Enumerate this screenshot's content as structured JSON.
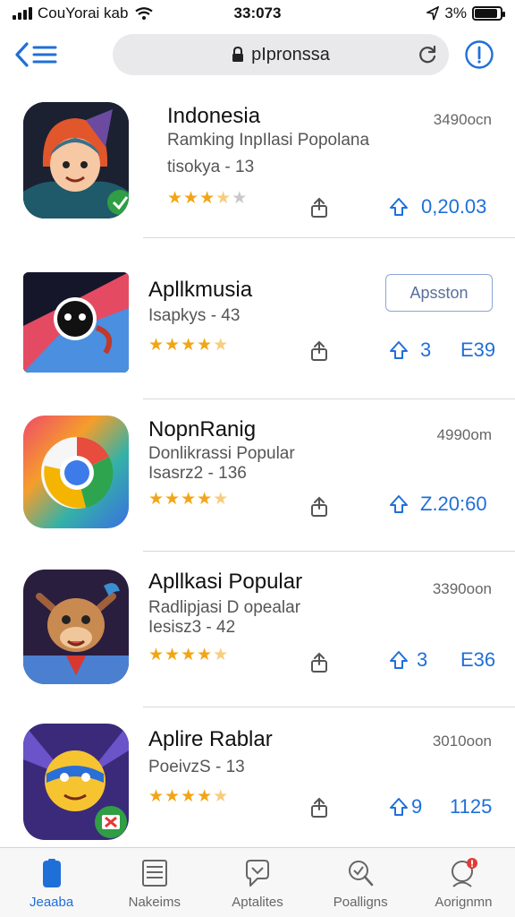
{
  "status_bar": {
    "carrier": "CouYorai kab",
    "time": "33:073",
    "battery": "3%",
    "battery_level": 0.9
  },
  "toolbar": {
    "url": "pIpronssa"
  },
  "apps": [
    {
      "name": "Indonesia",
      "subtitle": "Ramking InpIlasi Popolana",
      "meta": "tisokya - 13",
      "right_text": "3490ocn",
      "rating": 3.5,
      "upvote_count": "0,20.03",
      "icon": "character-witch-icon"
    },
    {
      "name": "Apllkmusia",
      "subtitle": "",
      "meta": "Isapkys - 43",
      "button_label": "Apsston",
      "rating": 4.5,
      "upvote_count": "3",
      "extra_count": "E39",
      "icon": "abstract-face-icon"
    },
    {
      "name": "NopnRanig",
      "subtitle": "Donlikrassi Popular",
      "meta": "Isasrz2 - 136",
      "right_text": "4990om",
      "rating": 4.5,
      "upvote_count": "Z.20:60",
      "icon": "rainbow-circle-icon"
    },
    {
      "name": "Apllkasi Popular",
      "subtitle": "Radlipjasi D opealar",
      "meta": "Iesisz3 - 42",
      "right_text": "3390oon",
      "rating": 4.5,
      "upvote_count": "3",
      "extra_count": "E36",
      "icon": "cartoon-cow-icon"
    },
    {
      "name": "Aplire Rablar",
      "subtitle": "",
      "meta": "PoeivzS - 13",
      "right_text": "3010oon",
      "rating": 4.5,
      "upvote_count": "9",
      "extra_count": "1125",
      "icon": "masked-hero-icon"
    }
  ],
  "tabs": [
    {
      "label": "Jeaaba",
      "icon": "phone-icon"
    },
    {
      "label": "Nakeims",
      "icon": "archive-icon"
    },
    {
      "label": "Aptalites",
      "icon": "chat-bubble-icon"
    },
    {
      "label": "Poalligns",
      "icon": "search-magnifier-icon"
    },
    {
      "label": "Aorignmn",
      "icon": "profile-icon"
    }
  ],
  "colors": {
    "accent": "#1f6fd9",
    "star": "#f2a516",
    "badge": "#e53935"
  }
}
